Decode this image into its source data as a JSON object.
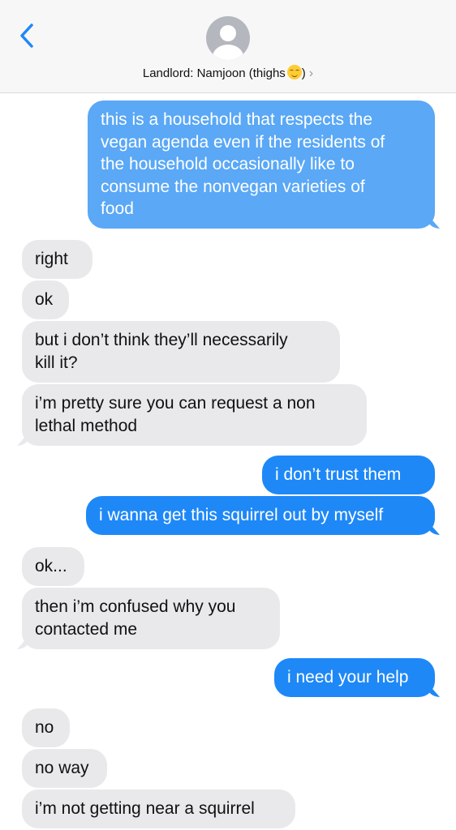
{
  "header": {
    "contact_name": "Landlord: Namjoon (thighs",
    "contact_name_end": ")",
    "chevron": "›",
    "back_icon": "chevron-left-icon",
    "avatar_icon": "person-silhouette-icon",
    "emoji_icon": "relieved-face-emoji"
  },
  "colors": {
    "sent_bubble": "#1e88f7",
    "sent_bubble_light": "#5aa8f6",
    "received_bubble": "#e9e9eb",
    "accent": "#1e88f7"
  },
  "messages": [
    {
      "dir": "sent",
      "lines": [
        "this is a household that respects the",
        "vegan agenda even if the residents of",
        "the household occasionally like to",
        "consume the nonvegan varieties of",
        "food"
      ]
    },
    {
      "dir": "received",
      "lines": [
        "right"
      ]
    },
    {
      "dir": "received",
      "lines": [
        "ok"
      ]
    },
    {
      "dir": "received",
      "lines": [
        "but i don’t think they’ll necessarily",
        "kill it?"
      ]
    },
    {
      "dir": "received",
      "lines": [
        "i’m pretty sure you can request a non",
        "lethal method"
      ]
    },
    {
      "dir": "sent",
      "lines": [
        "i don’t trust them"
      ]
    },
    {
      "dir": "sent",
      "lines": [
        "i wanna get this squirrel out by myself"
      ]
    },
    {
      "dir": "received",
      "lines": [
        "ok..."
      ]
    },
    {
      "dir": "received",
      "lines": [
        "then i’m confused why you",
        "contacted me"
      ]
    },
    {
      "dir": "sent",
      "lines": [
        "i need your help"
      ]
    },
    {
      "dir": "received",
      "lines": [
        "no"
      ]
    },
    {
      "dir": "received",
      "lines": [
        "no way"
      ]
    },
    {
      "dir": "received",
      "lines": [
        "i’m not getting near a squirrel"
      ]
    }
  ]
}
